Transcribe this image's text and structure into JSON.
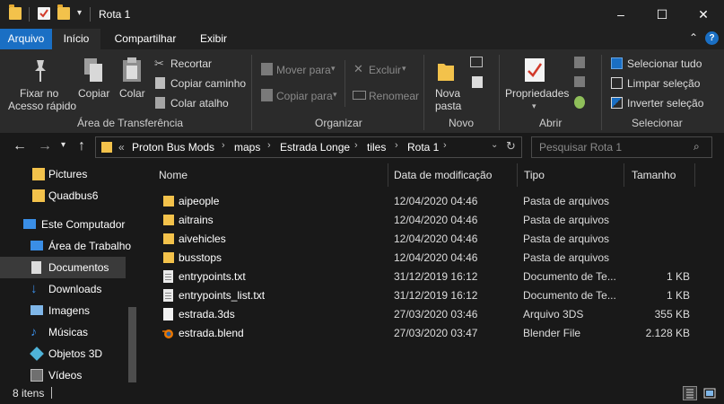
{
  "window": {
    "title": "Rota 1",
    "minimize": "–",
    "maximize": "☐",
    "close": "✕"
  },
  "ribbon_tabs": [
    "Arquivo",
    "Início",
    "Compartilhar",
    "Exibir"
  ],
  "ribbon": {
    "clipboard": {
      "pin_label_1": "Fixar no",
      "pin_label_2": "Acesso rápido",
      "copy": "Copiar",
      "paste": "Colar",
      "cut": "Recortar",
      "copy_path": "Copiar caminho",
      "paste_shortcut": "Colar atalho",
      "group": "Área de Transferência"
    },
    "organize": {
      "move_to": "Mover para",
      "copy_to": "Copiar para",
      "delete": "Excluir",
      "rename": "Renomear",
      "group": "Organizar"
    },
    "new": {
      "new_folder_1": "Nova",
      "new_folder_2": "pasta",
      "group": "Novo"
    },
    "open": {
      "properties": "Propriedades",
      "group": "Abrir"
    },
    "select": {
      "select_all": "Selecionar tudo",
      "select_none": "Limpar seleção",
      "invert": "Inverter seleção",
      "group": "Selecionar"
    }
  },
  "address": {
    "overflow": "«",
    "crumbs": [
      "Proton Bus Mods",
      "maps",
      "Estrada Longe",
      "tiles",
      "Rota 1"
    ],
    "search_placeholder": "Pesquisar Rota 1"
  },
  "sidebar": {
    "items": [
      {
        "label": "Pictures",
        "icon": "folder-icon"
      },
      {
        "label": "Quadbus6",
        "icon": "folder-icon"
      },
      {
        "label": "Este Computador",
        "icon": "computer-icon"
      },
      {
        "label": "Área de Trabalho",
        "icon": "desktop-icon"
      },
      {
        "label": "Documentos",
        "icon": "documents-icon"
      },
      {
        "label": "Downloads",
        "icon": "downloads-icon"
      },
      {
        "label": "Imagens",
        "icon": "images-icon"
      },
      {
        "label": "Músicas",
        "icon": "music-icon"
      },
      {
        "label": "Objetos 3D",
        "icon": "objects3d-icon"
      },
      {
        "label": "Vídeos",
        "icon": "videos-icon"
      }
    ]
  },
  "columns": [
    "Nome",
    "Data de modificação",
    "Tipo",
    "Tamanho"
  ],
  "files": [
    {
      "name": "aipeople",
      "date": "12/04/2020 04:46",
      "type": "Pasta de arquivos",
      "size": "",
      "icon": "folder-icon"
    },
    {
      "name": "aitrains",
      "date": "12/04/2020 04:46",
      "type": "Pasta de arquivos",
      "size": "",
      "icon": "folder-icon"
    },
    {
      "name": "aivehicles",
      "date": "12/04/2020 04:46",
      "type": "Pasta de arquivos",
      "size": "",
      "icon": "folder-icon"
    },
    {
      "name": "busstops",
      "date": "12/04/2020 04:46",
      "type": "Pasta de arquivos",
      "size": "",
      "icon": "folder-icon"
    },
    {
      "name": "entrypoints.txt",
      "date": "31/12/2019 16:12",
      "type": "Documento de Te...",
      "size": "1 KB",
      "icon": "text-file-icon"
    },
    {
      "name": "entrypoints_list.txt",
      "date": "31/12/2019 16:12",
      "type": "Documento de Te...",
      "size": "1 KB",
      "icon": "text-file-icon"
    },
    {
      "name": "estrada.3ds",
      "date": "27/03/2020 03:46",
      "type": "Arquivo 3DS",
      "size": "355 KB",
      "icon": "file-icon"
    },
    {
      "name": "estrada.blend",
      "date": "27/03/2020 03:47",
      "type": "Blender File",
      "size": "2.128 KB",
      "icon": "blender-icon"
    }
  ],
  "status": {
    "count": "8 itens"
  },
  "colors": {
    "accent": "#1a6fc4",
    "folder": "#f3c24b",
    "background": "#191919"
  }
}
